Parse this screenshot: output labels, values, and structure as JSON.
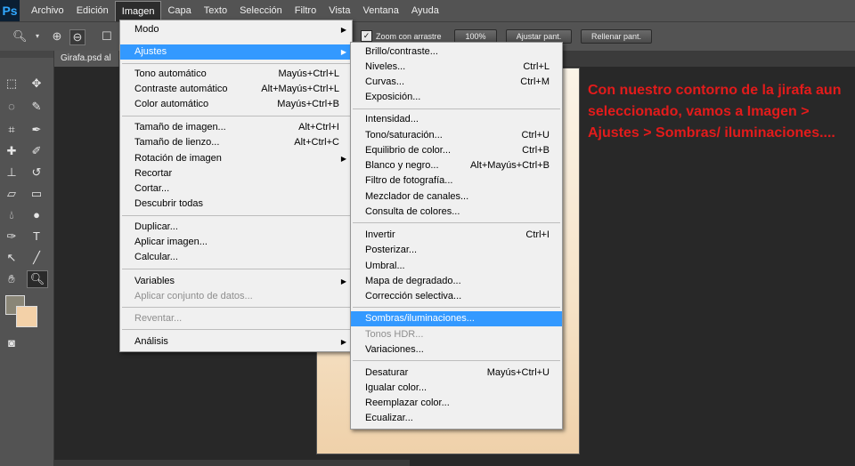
{
  "app": {
    "logo": "Ps"
  },
  "menubar": [
    "Archivo",
    "Edición",
    "Imagen",
    "Capa",
    "Texto",
    "Selección",
    "Filtro",
    "Vista",
    "Ventana",
    "Ayuda"
  ],
  "options": {
    "zoom_all_label": "Zoom con arrastre",
    "btn_100": "100%",
    "btn_fit": "Ajustar pant.",
    "btn_fill": "Rellenar pant."
  },
  "document": {
    "tab_label": "Girafa.psd al"
  },
  "annotation": "Con nuestro contorno de la jirafa aun seleccionado, vamos a Imagen > Ajustes > Sombras/ iluminaciones....",
  "imagen_menu": {
    "items": [
      {
        "label": "Modo",
        "shortcut": "",
        "submenu": true
      },
      {
        "label": "Ajustes",
        "shortcut": "",
        "submenu": true,
        "highlight": true
      },
      {
        "label": "Tono automático",
        "shortcut": "Mayús+Ctrl+L"
      },
      {
        "label": "Contraste automático",
        "shortcut": "Alt+Mayús+Ctrl+L"
      },
      {
        "label": "Color automático",
        "shortcut": "Mayús+Ctrl+B"
      },
      {
        "label": "Tamaño de imagen...",
        "shortcut": "Alt+Ctrl+I"
      },
      {
        "label": "Tamaño de lienzo...",
        "shortcut": "Alt+Ctrl+C"
      },
      {
        "label": "Rotación de imagen",
        "shortcut": "",
        "submenu": true
      },
      {
        "label": "Recortar",
        "shortcut": ""
      },
      {
        "label": "Cortar...",
        "shortcut": ""
      },
      {
        "label": "Descubrir todas",
        "shortcut": ""
      },
      {
        "label": "Duplicar...",
        "shortcut": ""
      },
      {
        "label": "Aplicar imagen...",
        "shortcut": ""
      },
      {
        "label": "Calcular...",
        "shortcut": ""
      },
      {
        "label": "Variables",
        "shortcut": "",
        "submenu": true
      },
      {
        "label": "Aplicar conjunto de datos...",
        "shortcut": "",
        "disabled": true
      },
      {
        "label": "Reventar...",
        "shortcut": "",
        "disabled": true
      },
      {
        "label": "Análisis",
        "shortcut": "",
        "submenu": true
      }
    ]
  },
  "ajustes_menu": {
    "items": [
      {
        "label": "Brillo/contraste...",
        "shortcut": ""
      },
      {
        "label": "Niveles...",
        "shortcut": "Ctrl+L"
      },
      {
        "label": "Curvas...",
        "shortcut": "Ctrl+M"
      },
      {
        "label": "Exposición...",
        "shortcut": ""
      },
      {
        "label": "Intensidad...",
        "shortcut": ""
      },
      {
        "label": "Tono/saturación...",
        "shortcut": "Ctrl+U"
      },
      {
        "label": "Equilibrio de color...",
        "shortcut": "Ctrl+B"
      },
      {
        "label": "Blanco y negro...",
        "shortcut": "Alt+Mayús+Ctrl+B"
      },
      {
        "label": "Filtro de fotografía...",
        "shortcut": ""
      },
      {
        "label": "Mezclador de canales...",
        "shortcut": ""
      },
      {
        "label": "Consulta de colores...",
        "shortcut": ""
      },
      {
        "label": "Invertir",
        "shortcut": "Ctrl+I"
      },
      {
        "label": "Posterizar...",
        "shortcut": ""
      },
      {
        "label": "Umbral...",
        "shortcut": ""
      },
      {
        "label": "Mapa de degradado...",
        "shortcut": ""
      },
      {
        "label": "Corrección selectiva...",
        "shortcut": ""
      },
      {
        "label": "Sombras/iluminaciones...",
        "shortcut": "",
        "highlight": true
      },
      {
        "label": "Tonos HDR...",
        "shortcut": "",
        "disabled": true
      },
      {
        "label": "Variaciones...",
        "shortcut": ""
      },
      {
        "label": "Desaturar",
        "shortcut": "Mayús+Ctrl+U"
      },
      {
        "label": "Igualar color...",
        "shortcut": ""
      },
      {
        "label": "Reemplazar color...",
        "shortcut": ""
      },
      {
        "label": "Ecualizar...",
        "shortcut": ""
      }
    ]
  },
  "colors": {
    "highlight": "#3399ff",
    "annotation": "#e31b1b",
    "foreground": "#8a8677",
    "background": "#f3d1a8"
  }
}
